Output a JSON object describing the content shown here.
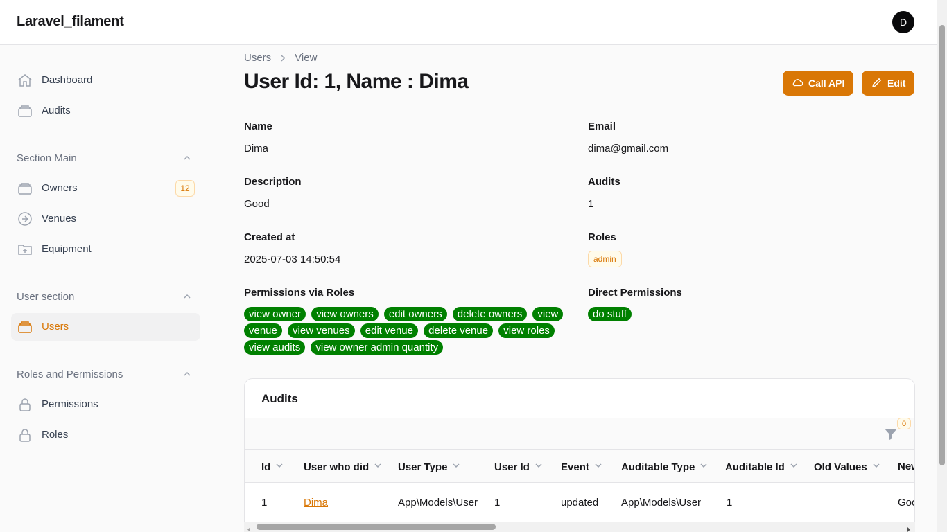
{
  "app": {
    "brand": "Laravel_filament",
    "avatar_initial": "D"
  },
  "sidebar": {
    "top_items": [
      {
        "label": "Dashboard",
        "icon": "home-icon"
      },
      {
        "label": "Audits",
        "icon": "stack-icon"
      }
    ],
    "groups": [
      {
        "label": "Section Main",
        "items": [
          {
            "label": "Owners",
            "icon": "stack-icon",
            "badge": "12"
          },
          {
            "label": "Venues",
            "icon": "arrow-circle-icon"
          },
          {
            "label": "Equipment",
            "icon": "folder-plus-icon"
          }
        ]
      },
      {
        "label": "User section",
        "items": [
          {
            "label": "Users",
            "icon": "stack-icon",
            "active": true
          }
        ]
      },
      {
        "label": "Roles and Permissions",
        "items": [
          {
            "label": "Permissions",
            "icon": "lock-icon"
          },
          {
            "label": "Roles",
            "icon": "lock-icon"
          }
        ]
      }
    ]
  },
  "breadcrumb": {
    "parent": "Users",
    "current": "View"
  },
  "page": {
    "title": "User Id: 1, Name : Dima"
  },
  "actions": {
    "call_api": "Call API",
    "edit": "Edit"
  },
  "fields": {
    "name_label": "Name",
    "name_value": "Dima",
    "email_label": "Email",
    "email_value": "dima@gmail.com",
    "description_label": "Description",
    "description_value": "Good",
    "audits_label": "Audits",
    "audits_value": "1",
    "created_label": "Created at",
    "created_value": "2025-07-03 14:50:54",
    "roles_label": "Roles",
    "roles_value": "admin",
    "perm_roles_label": "Permissions via Roles",
    "direct_label": "Direct Permissions"
  },
  "permissions_via_roles": [
    "view owner",
    "view owners",
    "edit owners",
    "delete owners",
    "view venue",
    "view venues",
    "edit venue",
    "delete venue",
    "view roles",
    "view audits",
    "view owner admin quantity"
  ],
  "direct_permissions": [
    "do stuff"
  ],
  "audits_table": {
    "title": "Audits",
    "filter_count": "0",
    "columns": [
      "Id",
      "User who did",
      "User Type",
      "User Id",
      "Event",
      "Auditable Type",
      "Auditable Id",
      "Old Values",
      "New"
    ],
    "rows": [
      [
        "1",
        "Dima",
        "App\\Models\\User",
        "1",
        "updated",
        "App\\Models\\User",
        "1",
        "",
        "Goo"
      ]
    ]
  },
  "colors": {
    "accent": "#d97706",
    "pill": "#008000"
  }
}
